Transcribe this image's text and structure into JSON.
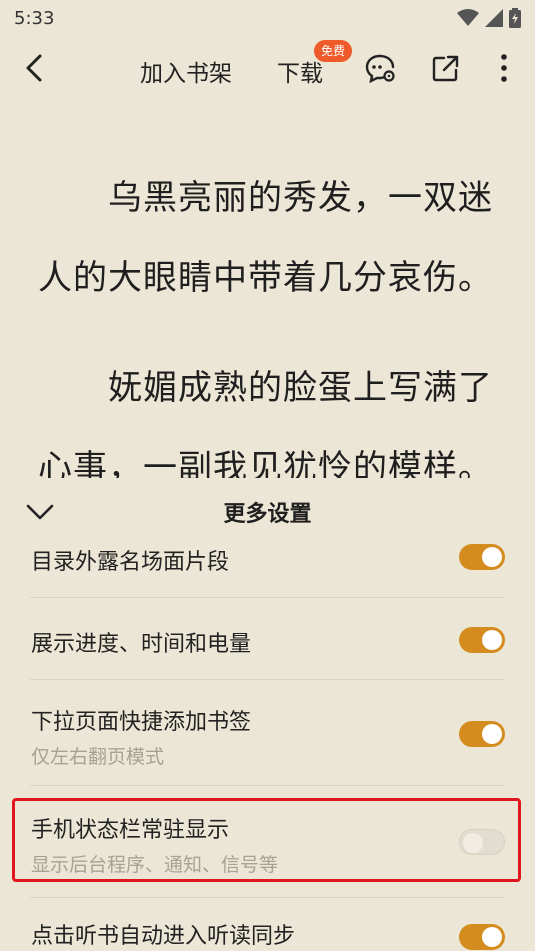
{
  "status": {
    "time": "5:33",
    "icons": [
      "wifi-icon",
      "signal-icon",
      "battery-charging-icon"
    ]
  },
  "toolbar": {
    "back_icon": "chevron-left-icon",
    "add_shelf": "加入书架",
    "download": "下载",
    "free_badge": "免费",
    "comment_icon": "comment-settings-icon",
    "share_icon": "share-icon",
    "more_icon": "more-vertical-icon"
  },
  "reading": {
    "line1": "乌黑亮丽的秀发，一双迷",
    "line2": "人的大眼睛中带着几分哀伤。",
    "line3": "妩媚成熟的脸蛋上写满了",
    "line4": "心事，一副我见犹怜的模样。"
  },
  "sheet": {
    "title": "更多设置",
    "collapse_icon": "chevron-down-icon",
    "settings": [
      {
        "label": "目录外露名场面片段",
        "sub": "",
        "on": true
      },
      {
        "label": "展示进度、时间和电量",
        "sub": "",
        "on": true
      },
      {
        "label": "下拉页面快捷添加书签",
        "sub": "仅左右翻页模式",
        "on": true
      },
      {
        "label": "手机状态栏常驻显示",
        "sub": "显示后台程序、通知、信号等",
        "on": false
      },
      {
        "label": "点击听书自动进入听读同步",
        "sub": "",
        "on": true
      }
    ]
  },
  "colors": {
    "background": "#ece6d6",
    "toggle_on": "#d48c1e",
    "badge": "#ef5a2a",
    "highlight": "#e0161e"
  }
}
